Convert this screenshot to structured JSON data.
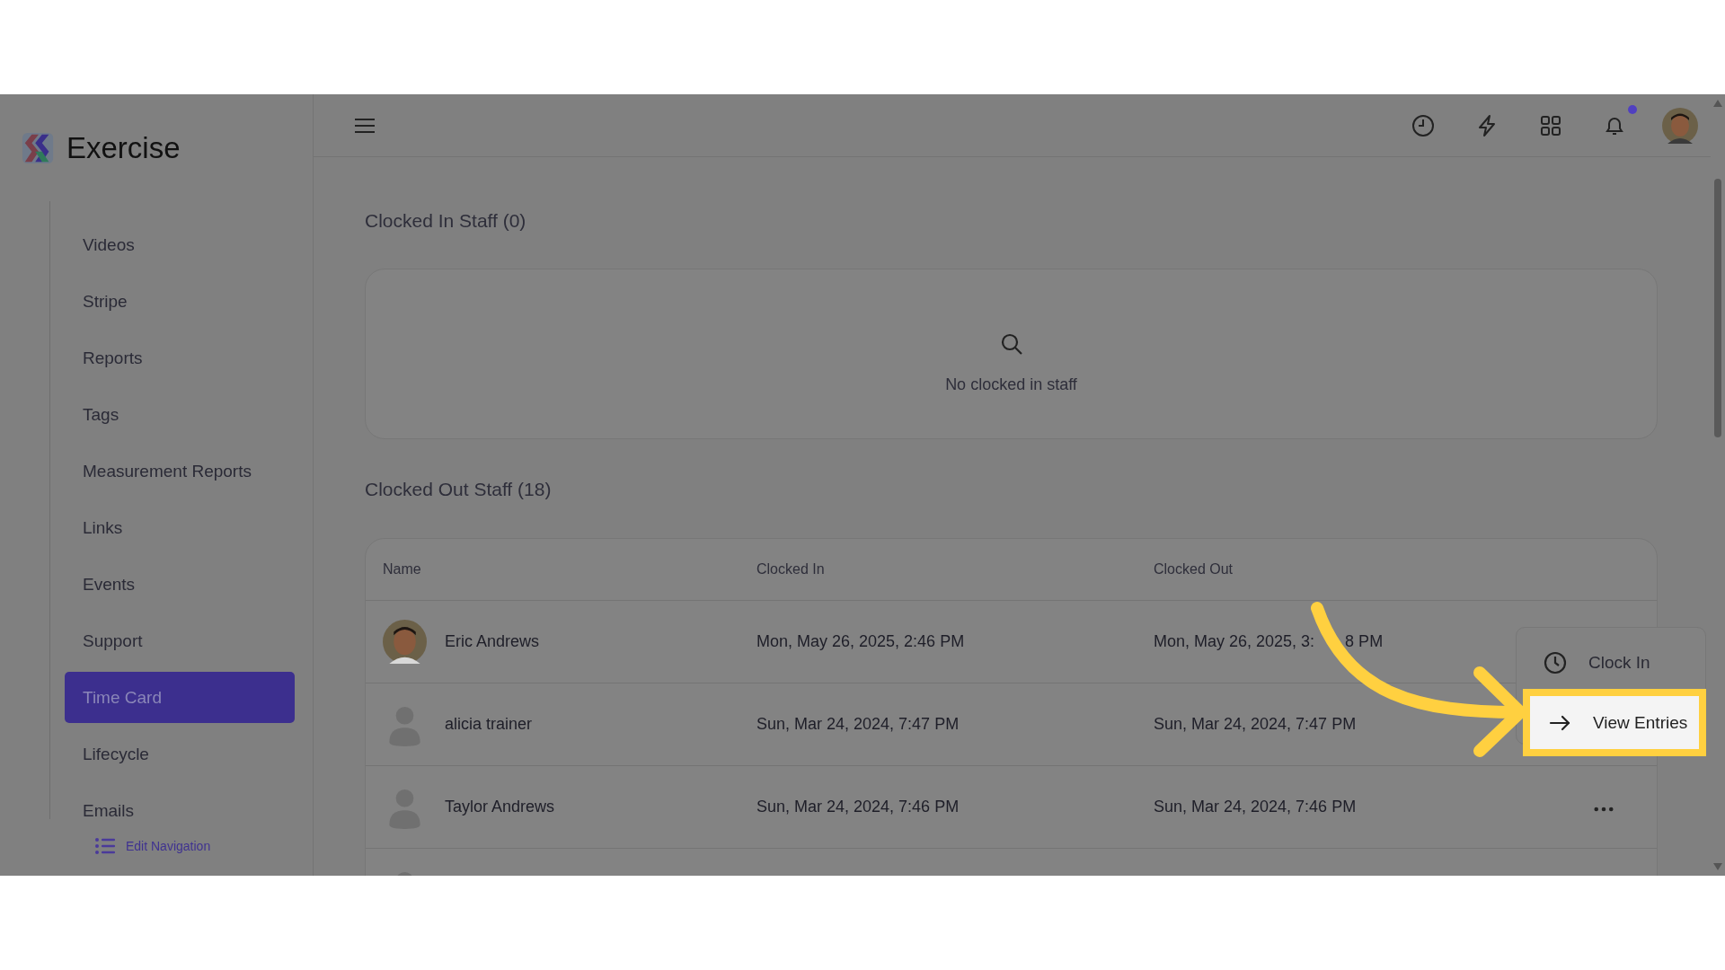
{
  "app": {
    "name": "Exercise"
  },
  "topbar": {
    "notifications_unread": true
  },
  "sidebar": {
    "items": [
      {
        "label": "Videos",
        "selected": false
      },
      {
        "label": "Stripe",
        "selected": false
      },
      {
        "label": "Reports",
        "selected": false
      },
      {
        "label": "Tags",
        "selected": false
      },
      {
        "label": "Measurement Reports",
        "selected": false
      },
      {
        "label": "Links",
        "selected": false
      },
      {
        "label": "Events",
        "selected": false
      },
      {
        "label": "Support",
        "selected": false
      },
      {
        "label": "Time Card",
        "selected": true
      },
      {
        "label": "Lifecycle",
        "selected": false
      },
      {
        "label": "Emails",
        "selected": false
      }
    ],
    "edit_link": "Edit Navigation"
  },
  "clocked_in": {
    "title": "Clocked In Staff (0)",
    "empty_text": "No clocked in staff"
  },
  "clocked_out": {
    "title": "Clocked Out Staff (18)",
    "columns": [
      "Name",
      "Clocked In",
      "Clocked Out"
    ],
    "rows": [
      {
        "name": "Eric Andrews",
        "clocked_in": "Mon, May 26, 2025, 2:46 PM",
        "clocked_out": "Mon, May 26, 2025, 3:",
        "clocked_out_tail": "8 PM"
      },
      {
        "kind": "default",
        "name": "alicia trainer",
        "clocked_in": "Sun, Mar 24, 2024, 7:47 PM",
        "clocked_out": "Sun, Mar 24, 2024, 7:47 PM"
      },
      {
        "kind": "default",
        "name": "Taylor Andrews",
        "clocked_in": "Sun, Mar 24, 2024, 7:46 PM",
        "clocked_out": "Sun, Mar 24, 2024, 7:46 PM",
        "more_button": true
      }
    ],
    "partial_row": true
  },
  "menu": {
    "items": [
      {
        "kind": "clock",
        "label": "Clock In",
        "highlighted": false
      },
      {
        "kind": "arrow",
        "label": "View Entries",
        "highlighted": true
      }
    ]
  }
}
